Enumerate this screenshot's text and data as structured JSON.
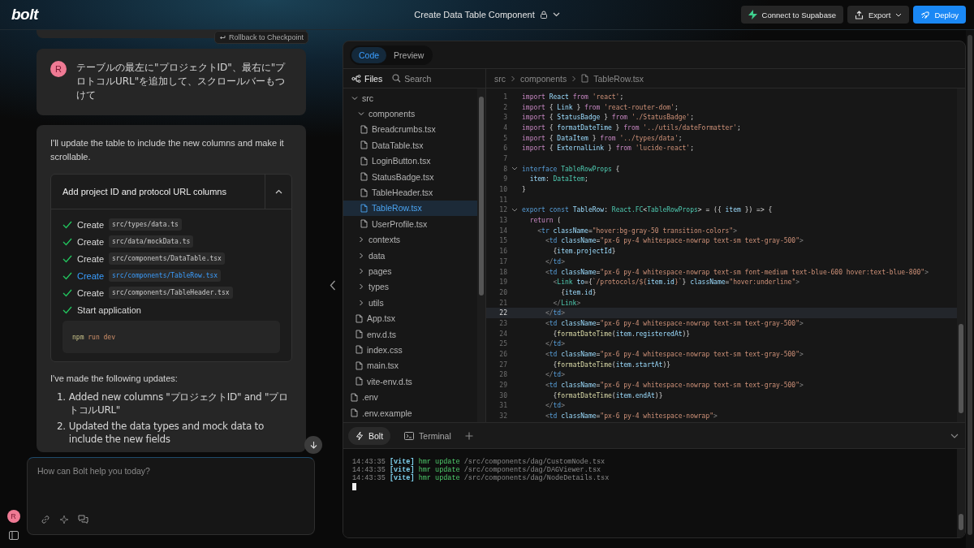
{
  "header": {
    "logo": "bolt",
    "title": "Create Data Table Component",
    "buttons": [
      {
        "kind": "supabase",
        "label": "Connect to Supabase"
      },
      {
        "kind": "export",
        "label": "Export"
      },
      {
        "kind": "deploy",
        "label": "Deploy"
      }
    ]
  },
  "chat": {
    "rollback": "Rollback to Checkpoint",
    "user_message": {
      "avatar": "R",
      "text": "テーブルの最左に\"プロジェクトID\"、最右に\"プロトコルURL\"を追加して、スクロールバーもつけて"
    },
    "assistant": {
      "intro": "I'll update the table to include the new columns and make it scrollable.",
      "action": {
        "title": "Add project ID and protocol URL columns",
        "expanded": true,
        "steps": [
          {
            "kind": "file",
            "done": true,
            "active": false,
            "label": "Create",
            "path": "src/types/data.ts"
          },
          {
            "kind": "file",
            "done": true,
            "active": false,
            "label": "Create",
            "path": "src/data/mockData.ts"
          },
          {
            "kind": "file",
            "done": true,
            "active": false,
            "label": "Create",
            "path": "src/components/DataTable.tsx"
          },
          {
            "kind": "file",
            "done": true,
            "active": true,
            "label": "Create",
            "path": "src/components/TableRow.tsx"
          },
          {
            "kind": "file",
            "done": true,
            "active": false,
            "label": "Create",
            "path": "src/components/TableHeader.tsx"
          },
          {
            "kind": "shell",
            "done": true,
            "active": false,
            "label": "Start application",
            "command": "npm",
            "args": "run dev"
          }
        ]
      },
      "summary": "I've made the following updates:",
      "updates": [
        {
          "number": "1.",
          "text": "Added new columns \"プロジェクトID\" and \"プロトコルURL\""
        },
        {
          "number": "2.",
          "text": "Updated the data types and mock data to include the new fields"
        }
      ]
    },
    "input": {
      "placeholder": "How can Bolt help you today?"
    },
    "user_avatar": "R"
  },
  "workbench": {
    "tabs": [
      {
        "label": "Code",
        "selected": true
      },
      {
        "label": "Preview",
        "selected": false
      }
    ],
    "sidebar_tabs": [
      {
        "kind": "files",
        "label": "Files",
        "selected": true
      },
      {
        "kind": "search",
        "label": "Search",
        "selected": false
      }
    ],
    "breadcrumb": [
      "src",
      "components",
      "TableRow.tsx"
    ],
    "tree": [
      {
        "kind": "folder",
        "name": "src",
        "expanded": true,
        "children": [
          {
            "kind": "folder",
            "name": "components",
            "expanded": true,
            "children": [
              {
                "kind": "file",
                "name": "Breadcrumbs.tsx",
                "selected": false
              },
              {
                "kind": "file",
                "name": "DataTable.tsx",
                "selected": false
              },
              {
                "kind": "file",
                "name": "LoginButton.tsx",
                "selected": false
              },
              {
                "kind": "file",
                "name": "StatusBadge.tsx",
                "selected": false
              },
              {
                "kind": "file",
                "name": "TableHeader.tsx",
                "selected": false
              },
              {
                "kind": "file",
                "name": "TableRow.tsx",
                "selected": true
              },
              {
                "kind": "file",
                "name": "UserProfile.tsx",
                "selected": false
              }
            ]
          },
          {
            "kind": "folder",
            "name": "contexts",
            "expanded": false
          },
          {
            "kind": "folder",
            "name": "data",
            "expanded": false
          },
          {
            "kind": "folder",
            "name": "pages",
            "expanded": false
          },
          {
            "kind": "folder",
            "name": "types",
            "expanded": false
          },
          {
            "kind": "folder",
            "name": "utils",
            "expanded": false
          },
          {
            "kind": "file",
            "name": "App.tsx",
            "selected": false
          },
          {
            "kind": "file",
            "name": "env.d.ts",
            "selected": false
          },
          {
            "kind": "file",
            "name": "index.css",
            "selected": false
          },
          {
            "kind": "file",
            "name": "main.tsx",
            "selected": false
          },
          {
            "kind": "file",
            "name": "vite-env.d.ts",
            "selected": false
          }
        ]
      },
      {
        "kind": "file",
        "name": ".env",
        "selected": false
      },
      {
        "kind": "file",
        "name": ".env.example",
        "selected": false
      }
    ],
    "code": [
      {
        "number": "1",
        "fold": false,
        "current": false,
        "tokens": [
          {
            "kind": "kw",
            "text": "import"
          },
          {
            "kind": "id",
            "text": " React"
          },
          {
            "kind": "kw",
            "text": " from"
          },
          {
            "kind": "str",
            "text": " 'react'"
          },
          {
            "kind": "p",
            "text": ";"
          }
        ]
      },
      {
        "number": "2",
        "fold": false,
        "current": false,
        "tokens": [
          {
            "kind": "kw",
            "text": "import"
          },
          {
            "kind": "p",
            "text": " {"
          },
          {
            "kind": "id",
            "text": " Link"
          },
          {
            "kind": "p",
            "text": " }"
          },
          {
            "kind": "kw",
            "text": " from"
          },
          {
            "kind": "str",
            "text": " 'react-router-dom'"
          },
          {
            "kind": "p",
            "text": ";"
          }
        ]
      },
      {
        "number": "3",
        "fold": false,
        "current": false,
        "tokens": [
          {
            "kind": "kw",
            "text": "import"
          },
          {
            "kind": "p",
            "text": " {"
          },
          {
            "kind": "id",
            "text": " StatusBadge"
          },
          {
            "kind": "p",
            "text": " }"
          },
          {
            "kind": "kw",
            "text": " from"
          },
          {
            "kind": "str",
            "text": " './StatusBadge'"
          },
          {
            "kind": "p",
            "text": ";"
          }
        ]
      },
      {
        "number": "4",
        "fold": false,
        "current": false,
        "tokens": [
          {
            "kind": "kw",
            "text": "import"
          },
          {
            "kind": "p",
            "text": " {"
          },
          {
            "kind": "id",
            "text": " formatDateTime"
          },
          {
            "kind": "p",
            "text": " }"
          },
          {
            "kind": "kw",
            "text": " from"
          },
          {
            "kind": "str",
            "text": " '../utils/dateFormatter'"
          },
          {
            "kind": "p",
            "text": ";"
          }
        ]
      },
      {
        "number": "5",
        "fold": false,
        "current": false,
        "tokens": [
          {
            "kind": "kw",
            "text": "import"
          },
          {
            "kind": "p",
            "text": " {"
          },
          {
            "kind": "id",
            "text": " DataItem"
          },
          {
            "kind": "p",
            "text": " }"
          },
          {
            "kind": "kw",
            "text": " from"
          },
          {
            "kind": "str",
            "text": " '../types/data'"
          },
          {
            "kind": "p",
            "text": ";"
          }
        ]
      },
      {
        "number": "6",
        "fold": false,
        "current": false,
        "tokens": [
          {
            "kind": "kw",
            "text": "import"
          },
          {
            "kind": "p",
            "text": " {"
          },
          {
            "kind": "id",
            "text": " ExternalLink"
          },
          {
            "kind": "p",
            "text": " }"
          },
          {
            "kind": "kw",
            "text": " from"
          },
          {
            "kind": "str",
            "text": " 'lucide-react'"
          },
          {
            "kind": "p",
            "text": ";"
          }
        ]
      },
      {
        "number": "7",
        "fold": false,
        "current": false
      },
      {
        "number": "8",
        "fold": true,
        "current": false,
        "tokens": [
          {
            "kind": "dec",
            "text": "interface"
          },
          {
            "kind": "type",
            "text": " TableRowProps"
          },
          {
            "kind": "p",
            "text": " {"
          }
        ]
      },
      {
        "number": "9",
        "fold": false,
        "current": false,
        "tokens": [
          {
            "kind": "id",
            "text": "  item"
          },
          {
            "kind": "p",
            "text": ":"
          },
          {
            "kind": "type",
            "text": " DataItem"
          },
          {
            "kind": "p",
            "text": ";"
          }
        ]
      },
      {
        "number": "10",
        "fold": false,
        "current": false,
        "tokens": [
          {
            "kind": "p",
            "text": "}"
          }
        ]
      },
      {
        "number": "11",
        "fold": false,
        "current": false
      },
      {
        "number": "12",
        "fold": true,
        "current": false,
        "tokens": [
          {
            "kind": "dec",
            "text": "export"
          },
          {
            "kind": "dec",
            "text": " const"
          },
          {
            "kind": "id",
            "text": " TableRow"
          },
          {
            "kind": "p",
            "text": ":"
          },
          {
            "kind": "type",
            "text": " React.FC"
          },
          {
            "kind": "p",
            "text": "<"
          },
          {
            "kind": "type",
            "text": "TableRowProps"
          },
          {
            "kind": "p",
            "text": "> = ({"
          },
          {
            "kind": "id",
            "text": " item"
          },
          {
            "kind": "p",
            "text": " }) => {"
          }
        ]
      },
      {
        "number": "13",
        "fold": false,
        "current": false,
        "tokens": [
          {
            "kind": "kw",
            "text": "  return"
          },
          {
            "kind": "p",
            "text": " ("
          }
        ]
      },
      {
        "number": "14",
        "fold": false,
        "current": false,
        "tokens": [
          {
            "kind": "tag",
            "text": "    <"
          },
          {
            "kind": "dec",
            "text": "tr"
          },
          {
            "kind": "id",
            "text": " className"
          },
          {
            "kind": "p",
            "text": "="
          },
          {
            "kind": "str",
            "text": "\"hover:bg-gray-50 transition-colors\""
          },
          {
            "kind": "tag",
            "text": ">"
          }
        ]
      },
      {
        "number": "15",
        "fold": false,
        "current": false,
        "tokens": [
          {
            "kind": "tag",
            "text": "      <"
          },
          {
            "kind": "dec",
            "text": "td"
          },
          {
            "kind": "id",
            "text": " className"
          },
          {
            "kind": "p",
            "text": "="
          },
          {
            "kind": "str",
            "text": "\"px-6 py-4 whitespace-nowrap text-sm text-gray-500\""
          },
          {
            "kind": "tag",
            "text": ">"
          }
        ]
      },
      {
        "number": "16",
        "fold": false,
        "current": false,
        "tokens": [
          {
            "kind": "p",
            "text": "        {"
          },
          {
            "kind": "id",
            "text": "item"
          },
          {
            "kind": "p",
            "text": "."
          },
          {
            "kind": "id",
            "text": "projectId"
          },
          {
            "kind": "p",
            "text": "}"
          }
        ]
      },
      {
        "number": "17",
        "fold": false,
        "current": false,
        "tokens": [
          {
            "kind": "tag",
            "text": "      </"
          },
          {
            "kind": "dec",
            "text": "td"
          },
          {
            "kind": "tag",
            "text": ">"
          }
        ]
      },
      {
        "number": "18",
        "fold": false,
        "current": false,
        "tokens": [
          {
            "kind": "tag",
            "text": "      <"
          },
          {
            "kind": "dec",
            "text": "td"
          },
          {
            "kind": "id",
            "text": " className"
          },
          {
            "kind": "p",
            "text": "="
          },
          {
            "kind": "str",
            "text": "\"px-6 py-4 whitespace-nowrap text-sm font-medium text-blue-600 hover:text-blue-800\""
          },
          {
            "kind": "tag",
            "text": ">"
          }
        ]
      },
      {
        "number": "19",
        "fold": false,
        "current": false,
        "tokens": [
          {
            "kind": "tag",
            "text": "        <"
          },
          {
            "kind": "type",
            "text": "Link"
          },
          {
            "kind": "id",
            "text": " to"
          },
          {
            "kind": "p",
            "text": "={"
          },
          {
            "kind": "str",
            "text": "`/protocols/${"
          },
          {
            "kind": "id",
            "text": "item.id"
          },
          {
            "kind": "str",
            "text": "}`"
          },
          {
            "kind": "p",
            "text": "}"
          },
          {
            "kind": "id",
            "text": " className"
          },
          {
            "kind": "p",
            "text": "="
          },
          {
            "kind": "str",
            "text": "\"hover:underline\""
          },
          {
            "kind": "tag",
            "text": ">"
          }
        ]
      },
      {
        "number": "20",
        "fold": false,
        "current": false,
        "tokens": [
          {
            "kind": "p",
            "text": "          {"
          },
          {
            "kind": "id",
            "text": "item"
          },
          {
            "kind": "p",
            "text": "."
          },
          {
            "kind": "id",
            "text": "id"
          },
          {
            "kind": "p",
            "text": "}"
          }
        ]
      },
      {
        "number": "21",
        "fold": false,
        "current": false,
        "tokens": [
          {
            "kind": "tag",
            "text": "        </"
          },
          {
            "kind": "type",
            "text": "Link"
          },
          {
            "kind": "tag",
            "text": ">"
          }
        ]
      },
      {
        "number": "22",
        "fold": false,
        "current": true,
        "tokens": [
          {
            "kind": "tag",
            "text": "      </"
          },
          {
            "kind": "dec",
            "text": "td"
          },
          {
            "kind": "tag",
            "text": ">"
          }
        ]
      },
      {
        "number": "23",
        "fold": false,
        "current": false,
        "tokens": [
          {
            "kind": "tag",
            "text": "      <"
          },
          {
            "kind": "dec",
            "text": "td"
          },
          {
            "kind": "id",
            "text": " className"
          },
          {
            "kind": "p",
            "text": "="
          },
          {
            "kind": "str",
            "text": "\"px-6 py-4 whitespace-nowrap text-sm text-gray-500\""
          },
          {
            "kind": "tag",
            "text": ">"
          }
        ]
      },
      {
        "number": "24",
        "fold": false,
        "current": false,
        "tokens": [
          {
            "kind": "p",
            "text": "        {"
          },
          {
            "kind": "fn",
            "text": "formatDateTime"
          },
          {
            "kind": "p",
            "text": "("
          },
          {
            "kind": "id",
            "text": "item"
          },
          {
            "kind": "p",
            "text": "."
          },
          {
            "kind": "id",
            "text": "registeredAt"
          },
          {
            "kind": "p",
            "text": ")}"
          }
        ]
      },
      {
        "number": "25",
        "fold": false,
        "current": false,
        "tokens": [
          {
            "kind": "tag",
            "text": "      </"
          },
          {
            "kind": "dec",
            "text": "td"
          },
          {
            "kind": "tag",
            "text": ">"
          }
        ]
      },
      {
        "number": "26",
        "fold": false,
        "current": false,
        "tokens": [
          {
            "kind": "tag",
            "text": "      <"
          },
          {
            "kind": "dec",
            "text": "td"
          },
          {
            "kind": "id",
            "text": " className"
          },
          {
            "kind": "p",
            "text": "="
          },
          {
            "kind": "str",
            "text": "\"px-6 py-4 whitespace-nowrap text-sm text-gray-500\""
          },
          {
            "kind": "tag",
            "text": ">"
          }
        ]
      },
      {
        "number": "27",
        "fold": false,
        "current": false,
        "tokens": [
          {
            "kind": "p",
            "text": "        {"
          },
          {
            "kind": "fn",
            "text": "formatDateTime"
          },
          {
            "kind": "p",
            "text": "("
          },
          {
            "kind": "id",
            "text": "item"
          },
          {
            "kind": "p",
            "text": "."
          },
          {
            "kind": "id",
            "text": "startAt"
          },
          {
            "kind": "p",
            "text": ")}"
          }
        ]
      },
      {
        "number": "28",
        "fold": false,
        "current": false,
        "tokens": [
          {
            "kind": "tag",
            "text": "      </"
          },
          {
            "kind": "dec",
            "text": "td"
          },
          {
            "kind": "tag",
            "text": ">"
          }
        ]
      },
      {
        "number": "29",
        "fold": false,
        "current": false,
        "tokens": [
          {
            "kind": "tag",
            "text": "      <"
          },
          {
            "kind": "dec",
            "text": "td"
          },
          {
            "kind": "id",
            "text": " className"
          },
          {
            "kind": "p",
            "text": "="
          },
          {
            "kind": "str",
            "text": "\"px-6 py-4 whitespace-nowrap text-sm text-gray-500\""
          },
          {
            "kind": "tag",
            "text": ">"
          }
        ]
      },
      {
        "number": "30",
        "fold": false,
        "current": false,
        "tokens": [
          {
            "kind": "p",
            "text": "        {"
          },
          {
            "kind": "fn",
            "text": "formatDateTime"
          },
          {
            "kind": "p",
            "text": "("
          },
          {
            "kind": "id",
            "text": "item"
          },
          {
            "kind": "p",
            "text": "."
          },
          {
            "kind": "id",
            "text": "endAt"
          },
          {
            "kind": "p",
            "text": ")}"
          }
        ]
      },
      {
        "number": "31",
        "fold": false,
        "current": false,
        "tokens": [
          {
            "kind": "tag",
            "text": "      </"
          },
          {
            "kind": "dec",
            "text": "td"
          },
          {
            "kind": "tag",
            "text": ">"
          }
        ]
      },
      {
        "number": "32",
        "fold": false,
        "current": false,
        "tokens": [
          {
            "kind": "tag",
            "text": "      <"
          },
          {
            "kind": "dec",
            "text": "td"
          },
          {
            "kind": "id",
            "text": " className"
          },
          {
            "kind": "p",
            "text": "="
          },
          {
            "kind": "str",
            "text": "\"px-6 py-4 whitespace-nowrap\""
          },
          {
            "kind": "tag",
            "text": ">"
          }
        ]
      }
    ],
    "panel_tabs": [
      {
        "kind": "bolt",
        "label": "Bolt",
        "selected": true
      },
      {
        "kind": "terminal",
        "label": "Terminal",
        "selected": false
      }
    ],
    "terminal": [
      {
        "time": "14:43:35",
        "tag": "[vite]",
        "event": "hmr update",
        "path": "/src/components/dag/CustomNode.tsx"
      },
      {
        "time": "14:43:35",
        "tag": "[vite]",
        "event": "hmr update",
        "path": "/src/components/dag/DAGViewer.tsx"
      },
      {
        "time": "14:43:35",
        "tag": "[vite]",
        "event": "hmr update",
        "path": "/src/components/dag/NodeDetails.tsx"
      }
    ]
  }
}
